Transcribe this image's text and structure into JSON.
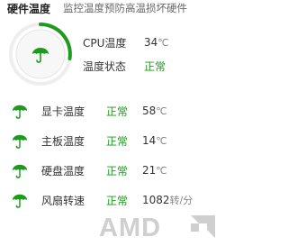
{
  "header": {
    "title": "硬件温度",
    "subtitle": "监控温度预防高温损坏硬件"
  },
  "cpu": {
    "temp_label": "CPU温度",
    "temp_value": "34",
    "temp_unit": "℃",
    "state_label": "温度状态",
    "state_value": "正常"
  },
  "rows": [
    {
      "label": "显卡温度",
      "status": "正常",
      "value": "58",
      "unit": "℃",
      "icon": "umbrella-icon"
    },
    {
      "label": "主板温度",
      "status": "正常",
      "value": "14",
      "unit": "℃",
      "icon": "umbrella-icon"
    },
    {
      "label": "硬盘温度",
      "status": "正常",
      "value": "21",
      "unit": "℃",
      "icon": "umbrella-icon"
    },
    {
      "label": "风扇转速",
      "status": "正常",
      "value": "1082",
      "unit": "转/分",
      "icon": "umbrella-icon"
    }
  ],
  "logo": {
    "text": "AMD"
  },
  "colors": {
    "accent": "#1e9a1e",
    "gauge_track": "#eeeeee",
    "logo": "#cfcfcf"
  }
}
